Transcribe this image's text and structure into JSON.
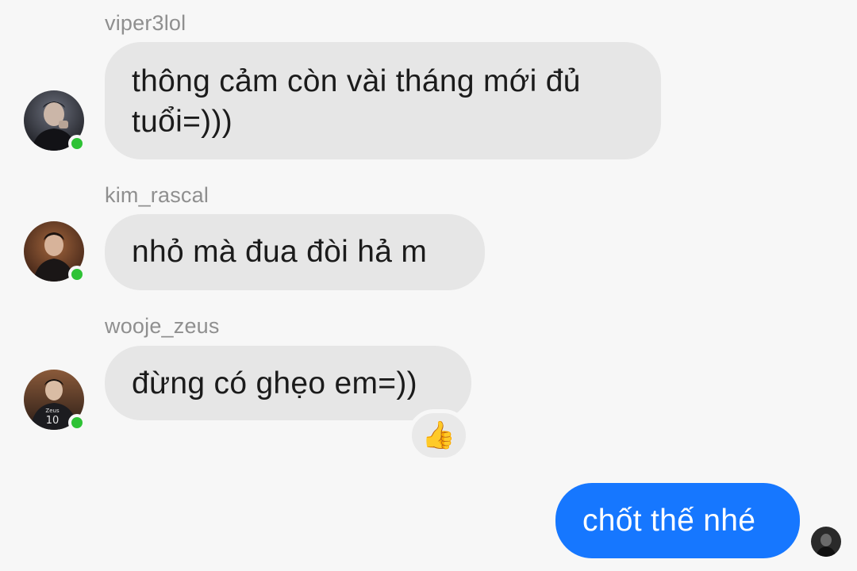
{
  "messages": [
    {
      "sender": "viper3lol",
      "text_line1": "thông cảm còn vài tháng mới đủ",
      "text_line2": "tuổi=)))"
    },
    {
      "sender": "kim_rascal",
      "text": "nhỏ mà đua đòi hả m"
    },
    {
      "sender": "wooje_zeus",
      "text": "đừng có ghẹo em=))",
      "reaction": "👍",
      "jersey_name": "Zeus",
      "jersey_number": "10"
    }
  ],
  "outgoing": {
    "text": "chốt thế nhé"
  },
  "colors": {
    "background": "#f7f7f7",
    "incoming_bubble": "#e6e6e6",
    "outgoing_bubble": "#1677ff",
    "online_status": "#2ec235",
    "sender_name": "#8f8f8f"
  },
  "icons": {
    "reaction": "thumbs-up-icon",
    "presence": "online-status-icon"
  }
}
